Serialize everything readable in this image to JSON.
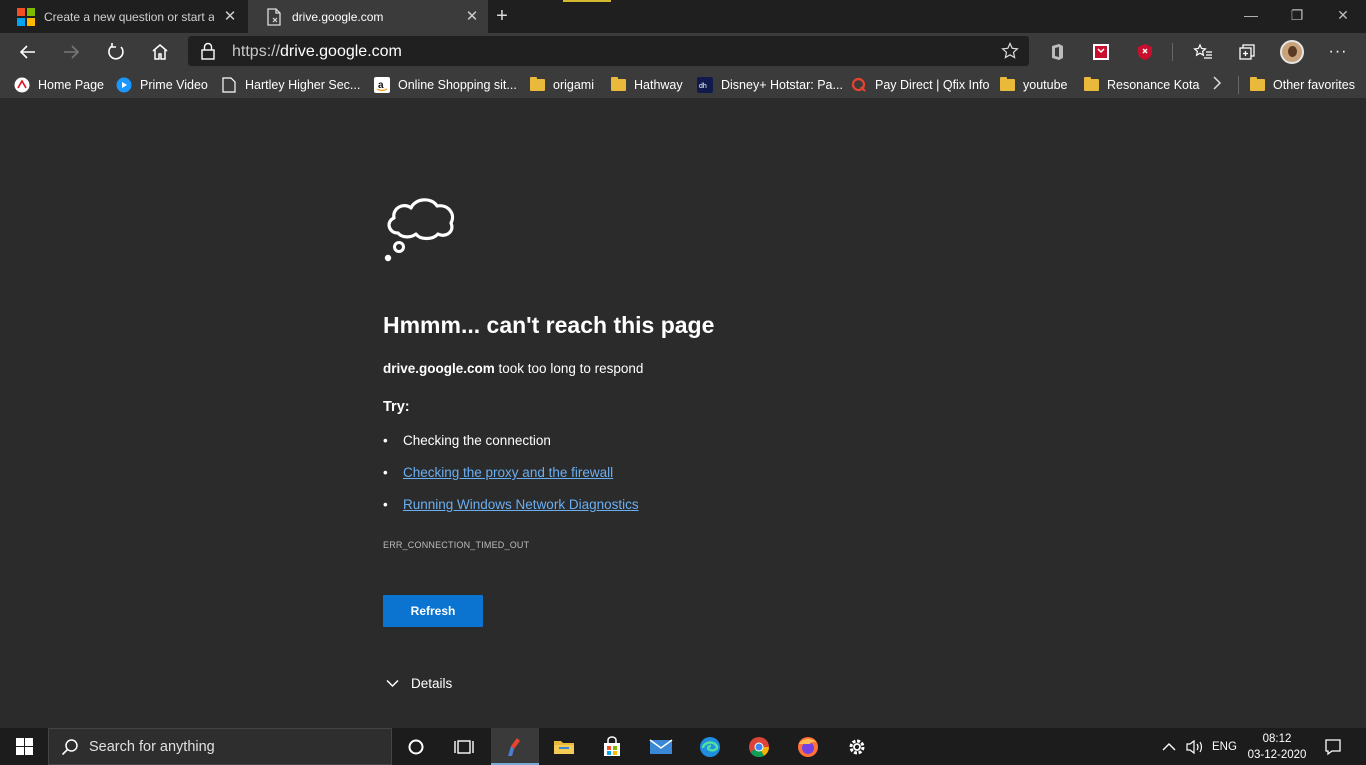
{
  "tabs": [
    {
      "title": "Create a new question or start a",
      "favicon": "microsoft-logo-icon",
      "active": false
    },
    {
      "title": "drive.google.com",
      "favicon": "page-error-icon",
      "active": true
    }
  ],
  "address": {
    "scheme": "https://",
    "host": "drive.google.com"
  },
  "favorites": [
    {
      "label": "Home Page",
      "icon": "ms-home-icon"
    },
    {
      "label": "Prime Video",
      "icon": "prime-video-icon"
    },
    {
      "label": "Hartley Higher Sec...",
      "icon": "page-icon"
    },
    {
      "label": "Online Shopping sit...",
      "icon": "amazon-icon"
    },
    {
      "label": "origami",
      "icon": "folder-icon"
    },
    {
      "label": "Hathway",
      "icon": "folder-icon"
    },
    {
      "label": "Disney+ Hotstar: Pa...",
      "icon": "hotstar-icon"
    },
    {
      "label": "Pay Direct | Qfix Info",
      "icon": "qfix-icon"
    },
    {
      "label": "youtube",
      "icon": "folder-icon"
    },
    {
      "label": "Resonance Kota",
      "icon": "folder-icon"
    }
  ],
  "other_favorites": "Other favorites",
  "error": {
    "title": "Hmmm... can't reach this page",
    "host": "drive.google.com",
    "message": " took too long to respond",
    "try_label": "Try:",
    "tips": [
      {
        "text": "Checking the connection",
        "link": false
      },
      {
        "text": "Checking the proxy and the firewall",
        "link": true
      },
      {
        "text": "Running Windows Network Diagnostics",
        "link": true
      }
    ],
    "code": "ERR_CONNECTION_TIMED_OUT",
    "refresh_label": "Refresh",
    "details_label": "Details"
  },
  "taskbar": {
    "search_placeholder": "Search for anything",
    "language": "ENG",
    "time": "08:12",
    "date": "03-12-2020"
  },
  "colors": {
    "accent": "#0a74d0",
    "link": "#6aaef2",
    "background": "#2b2b2b"
  }
}
